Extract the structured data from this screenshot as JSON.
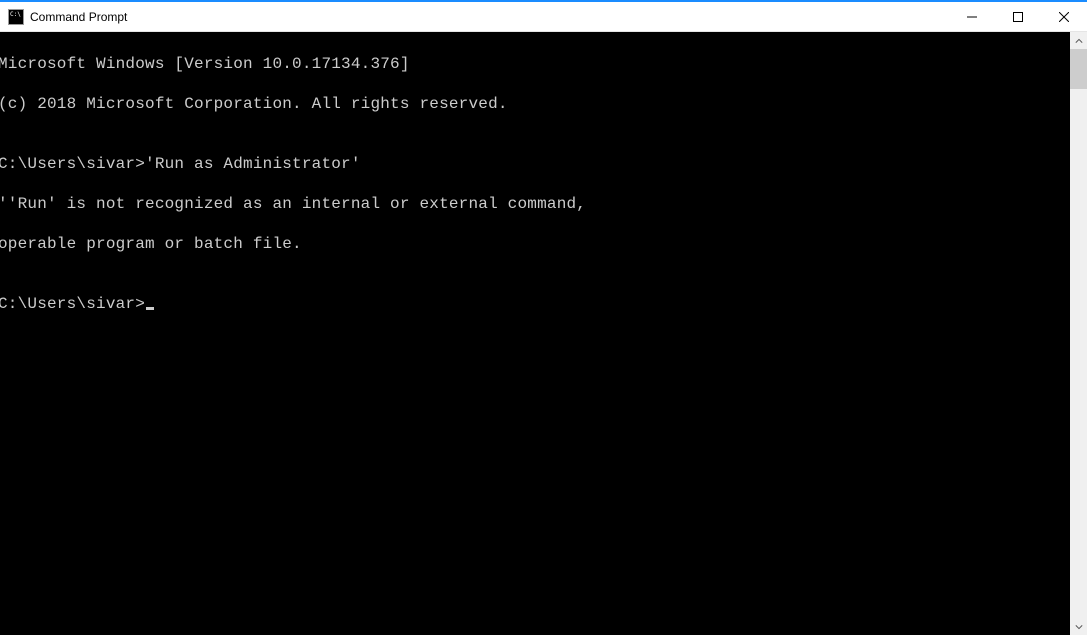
{
  "titlebar": {
    "title": "Command Prompt"
  },
  "console": {
    "lines": [
      "Microsoft Windows [Version 10.0.17134.376]",
      "(c) 2018 Microsoft Corporation. All rights reserved.",
      "",
      "C:\\Users\\sivar>'Run as Administrator'",
      "''Run' is not recognized as an internal or external command,",
      "operable program or batch file.",
      ""
    ],
    "prompt": "C:\\Users\\sivar>"
  }
}
